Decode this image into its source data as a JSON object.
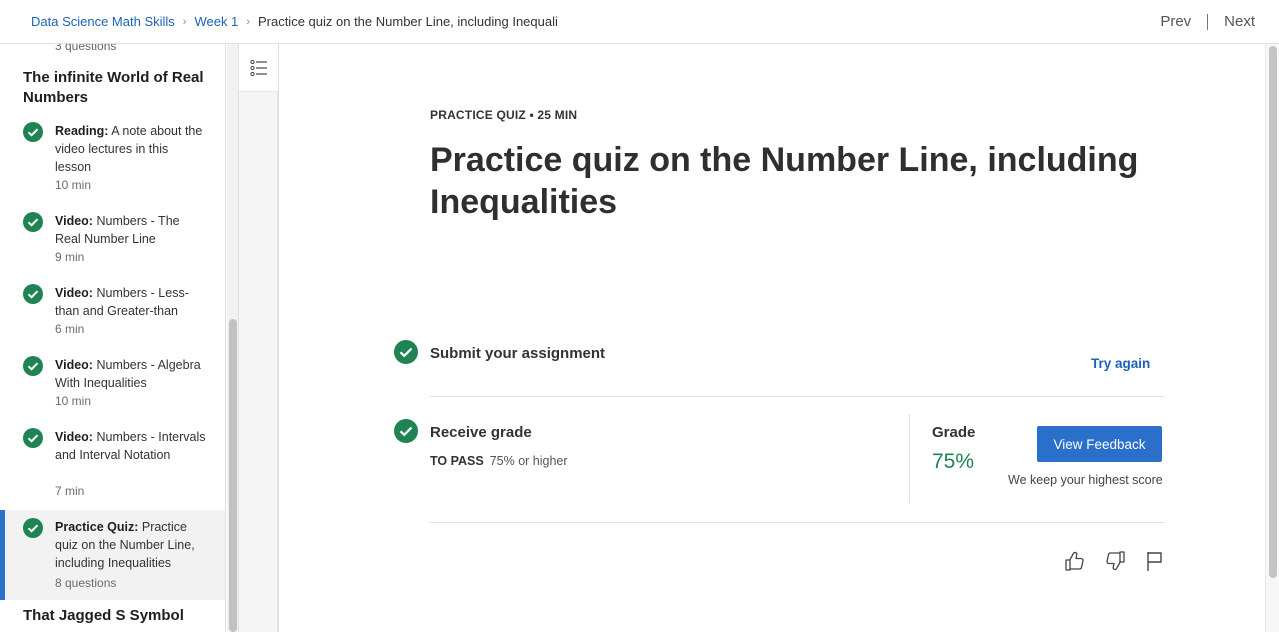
{
  "breadcrumb": {
    "course": "Data Science Math Skills",
    "week": "Week 1",
    "current": "Practice quiz on the Number Line, including Inequaliti"
  },
  "nav": {
    "prev": "Prev",
    "next": "Next"
  },
  "sidebar": {
    "prev_item_meta": "3 questions",
    "section1_title": "The infinite World of Real Numbers",
    "items": [
      {
        "type": "Reading:",
        "title": "A note about the video lectures in this lesson",
        "meta": "10 min"
      },
      {
        "type": "Video:",
        "title": "Numbers - The Real Number Line",
        "meta": "9 min"
      },
      {
        "type": "Video:",
        "title": "Numbers - Less-than and Greater-than",
        "meta": "6 min"
      },
      {
        "type": "Video:",
        "title": "Numbers - Algebra With Inequalities",
        "meta": "10 min"
      },
      {
        "type": "Video:",
        "title": "Numbers - Intervals and Interval Notation",
        "meta": "7 min"
      },
      {
        "type": "Practice Quiz:",
        "title": "Practice quiz on the Number Line, including Inequalities",
        "meta": "8 questions"
      }
    ],
    "section2_title": "That Jagged S Symbol"
  },
  "main": {
    "eyebrow": "PRACTICE QUIZ • 25 MIN",
    "title": "Practice quiz on the Number Line, including Inequalities",
    "submit_label": "Submit your assignment",
    "try_again": "Try again",
    "receive_label": "Receive grade",
    "to_pass_label": "TO PASS",
    "to_pass_value": "75% or higher",
    "grade_label": "Grade",
    "grade_value": "75%",
    "view_feedback": "View Feedback",
    "keep_note": "We keep your highest score"
  },
  "colors": {
    "accent": "#2a6fc9",
    "success": "#1f8354",
    "link": "#1b62b8"
  }
}
